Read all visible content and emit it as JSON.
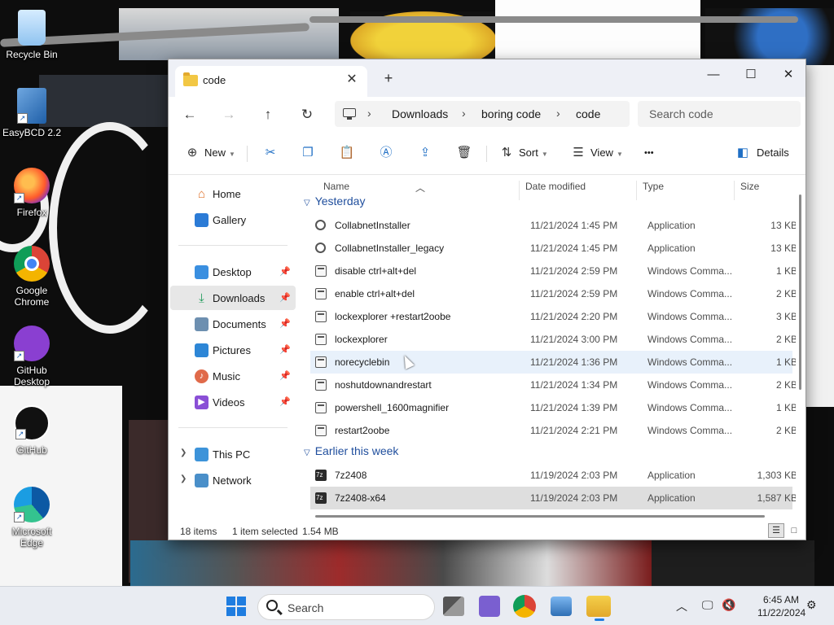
{
  "desktop": {
    "icons": [
      {
        "label": "Recycle Bin"
      },
      {
        "label": "EasyBCD 2.2"
      },
      {
        "label": "Firefox"
      },
      {
        "label": "Google Chrome"
      },
      {
        "label": "GitHub Desktop"
      },
      {
        "label": "GitHub"
      },
      {
        "label": "Microsoft Edge"
      }
    ]
  },
  "window": {
    "tab_title": "code",
    "new_tab_symbol": "+",
    "controls": {
      "minimize": "—",
      "maximize": "☐",
      "close": "✕"
    },
    "breadcrumb": [
      "Downloads",
      "boring code",
      "code"
    ],
    "search_placeholder": "Search code",
    "toolbar": {
      "new_label": "New",
      "sort_label": "Sort",
      "view_label": "View",
      "more_label": "•••",
      "details_label": "Details"
    },
    "nav": {
      "home": "Home",
      "gallery": "Gallery",
      "desktop": "Desktop",
      "downloads": "Downloads",
      "documents": "Documents",
      "pictures": "Pictures",
      "music": "Music",
      "videos": "Videos",
      "thispc": "This PC",
      "network": "Network"
    },
    "columns": {
      "name": "Name",
      "date": "Date modified",
      "type": "Type",
      "size": "Size"
    },
    "groups": {
      "yesterday": "Yesterday",
      "earlier": "Earlier this week"
    },
    "files": [
      {
        "name": "CollabnetInstaller",
        "date": "11/21/2024 1:45 PM",
        "type": "Application",
        "size": "13 KB"
      },
      {
        "name": "CollabnetInstaller_legacy",
        "date": "11/21/2024 1:45 PM",
        "type": "Application",
        "size": "13 KB"
      },
      {
        "name": "disable ctrl+alt+del",
        "date": "11/21/2024 2:59 PM",
        "type": "Windows Comma...",
        "size": "1 KB"
      },
      {
        "name": "enable ctrl+alt+del",
        "date": "11/21/2024 2:59 PM",
        "type": "Windows Comma...",
        "size": "2 KB"
      },
      {
        "name": "lockexplorer +restart2oobe",
        "date": "11/21/2024 2:20 PM",
        "type": "Windows Comma...",
        "size": "3 KB"
      },
      {
        "name": "lockexplorer",
        "date": "11/21/2024 3:00 PM",
        "type": "Windows Comma...",
        "size": "2 KB"
      },
      {
        "name": "norecyclebin",
        "date": "11/21/2024 1:36 PM",
        "type": "Windows Comma...",
        "size": "1 KB"
      },
      {
        "name": "noshutdownandrestart",
        "date": "11/21/2024 1:34 PM",
        "type": "Windows Comma...",
        "size": "2 KB"
      },
      {
        "name": "powershell_1600magnifier",
        "date": "11/21/2024 1:39 PM",
        "type": "Windows Comma...",
        "size": "1 KB"
      },
      {
        "name": "restart2oobe",
        "date": "11/21/2024 2:21 PM",
        "type": "Windows Comma...",
        "size": "2 KB"
      },
      {
        "name": "7z2408",
        "date": "11/19/2024 2:03 PM",
        "type": "Application",
        "size": "1,303 KB"
      },
      {
        "name": "7z2408-x64",
        "date": "11/19/2024 2:03 PM",
        "type": "Application",
        "size": "1,587 KB"
      }
    ],
    "status": {
      "items": "18 items",
      "selected": "1 item selected",
      "size": "1.54 MB"
    }
  },
  "taskbar": {
    "search_label": "Search",
    "time": "6:45 AM",
    "date": "11/22/2024"
  },
  "colors": {
    "accent": "#1f7de0",
    "group_header": "#1f4e9d",
    "selected_row": "#dedede",
    "hover_row": "#e8f1fb"
  }
}
